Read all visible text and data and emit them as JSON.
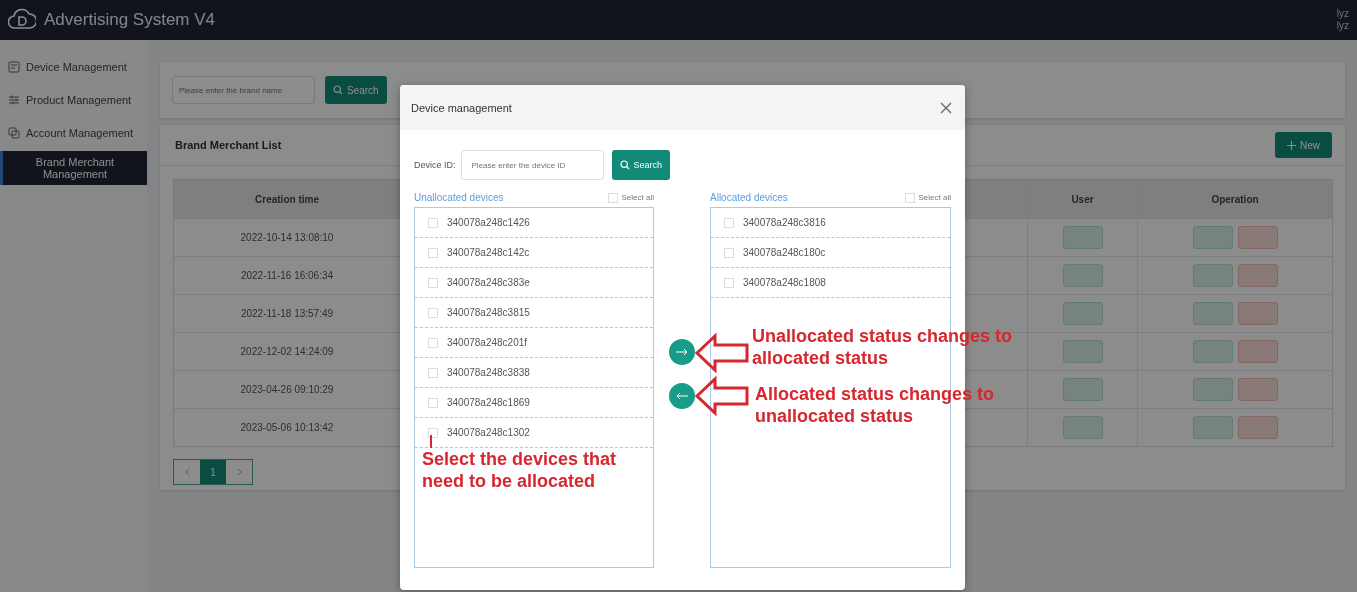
{
  "app": {
    "title": "Advertising System V4",
    "user_lines": [
      "lyz",
      "lyz"
    ]
  },
  "sidebar": {
    "items": [
      {
        "label": "Device Management",
        "selected": false,
        "kind": "device"
      },
      {
        "label": "Product Management",
        "selected": false,
        "kind": "product"
      },
      {
        "label": "Account Management",
        "selected": false,
        "kind": "account"
      },
      {
        "label": "Brand Merchant Management",
        "selected": true,
        "kind": "brand"
      }
    ]
  },
  "search": {
    "placeholder": "Please enter the brand name",
    "button": "Search"
  },
  "list": {
    "title": "Brand Merchant List",
    "new_button": "New",
    "columns": [
      "Creation time",
      "",
      "User",
      "Operation"
    ],
    "rows": [
      {
        "creation_time": "2022-10-14 13:08:10"
      },
      {
        "creation_time": "2022-11-16 16:06:34"
      },
      {
        "creation_time": "2022-11-18 13:57:49"
      },
      {
        "creation_time": "2022-12-02 14:24:09"
      },
      {
        "creation_time": "2023-04-26 09:10:29"
      },
      {
        "creation_time": "2023-05-06 10:13:42"
      }
    ],
    "pagination": {
      "pages": [
        {
          "label": "1",
          "selected": true
        }
      ]
    }
  },
  "dialog": {
    "title": "Device management",
    "device_id_label": "Device ID:",
    "device_id_placeholder": "Please enter the device ID",
    "search_button": "Search",
    "unallocated": {
      "title": "Unallocated devices",
      "select_all": "Select all",
      "select_all_checked": false,
      "devices": [
        {
          "id": "340078a248c1426",
          "checked": false
        },
        {
          "id": "340078a248c142c",
          "checked": false
        },
        {
          "id": "340078a248c383e",
          "checked": false
        },
        {
          "id": "340078a248c3815",
          "checked": false
        },
        {
          "id": "340078a248c201f",
          "checked": false
        },
        {
          "id": "340078a248c3838",
          "checked": false
        },
        {
          "id": "340078a248c1869",
          "checked": false
        },
        {
          "id": "340078a248c1302",
          "checked": false
        }
      ]
    },
    "allocated": {
      "title": "Allocated devices",
      "select_all": "Select all",
      "select_all_checked": false,
      "devices": [
        {
          "id": "340078a248c3816",
          "checked": false
        },
        {
          "id": "340078a248c180c",
          "checked": false
        },
        {
          "id": "340078a248c1808",
          "checked": false
        }
      ]
    }
  },
  "annotations": [
    {
      "kind": "left-list",
      "text": "Select the devices that need to be allocated"
    },
    {
      "kind": "to-right",
      "text": "Unallocated status changes to allocated status"
    },
    {
      "kind": "to-left",
      "text": "Allocated status changes to unallocated status"
    }
  ]
}
